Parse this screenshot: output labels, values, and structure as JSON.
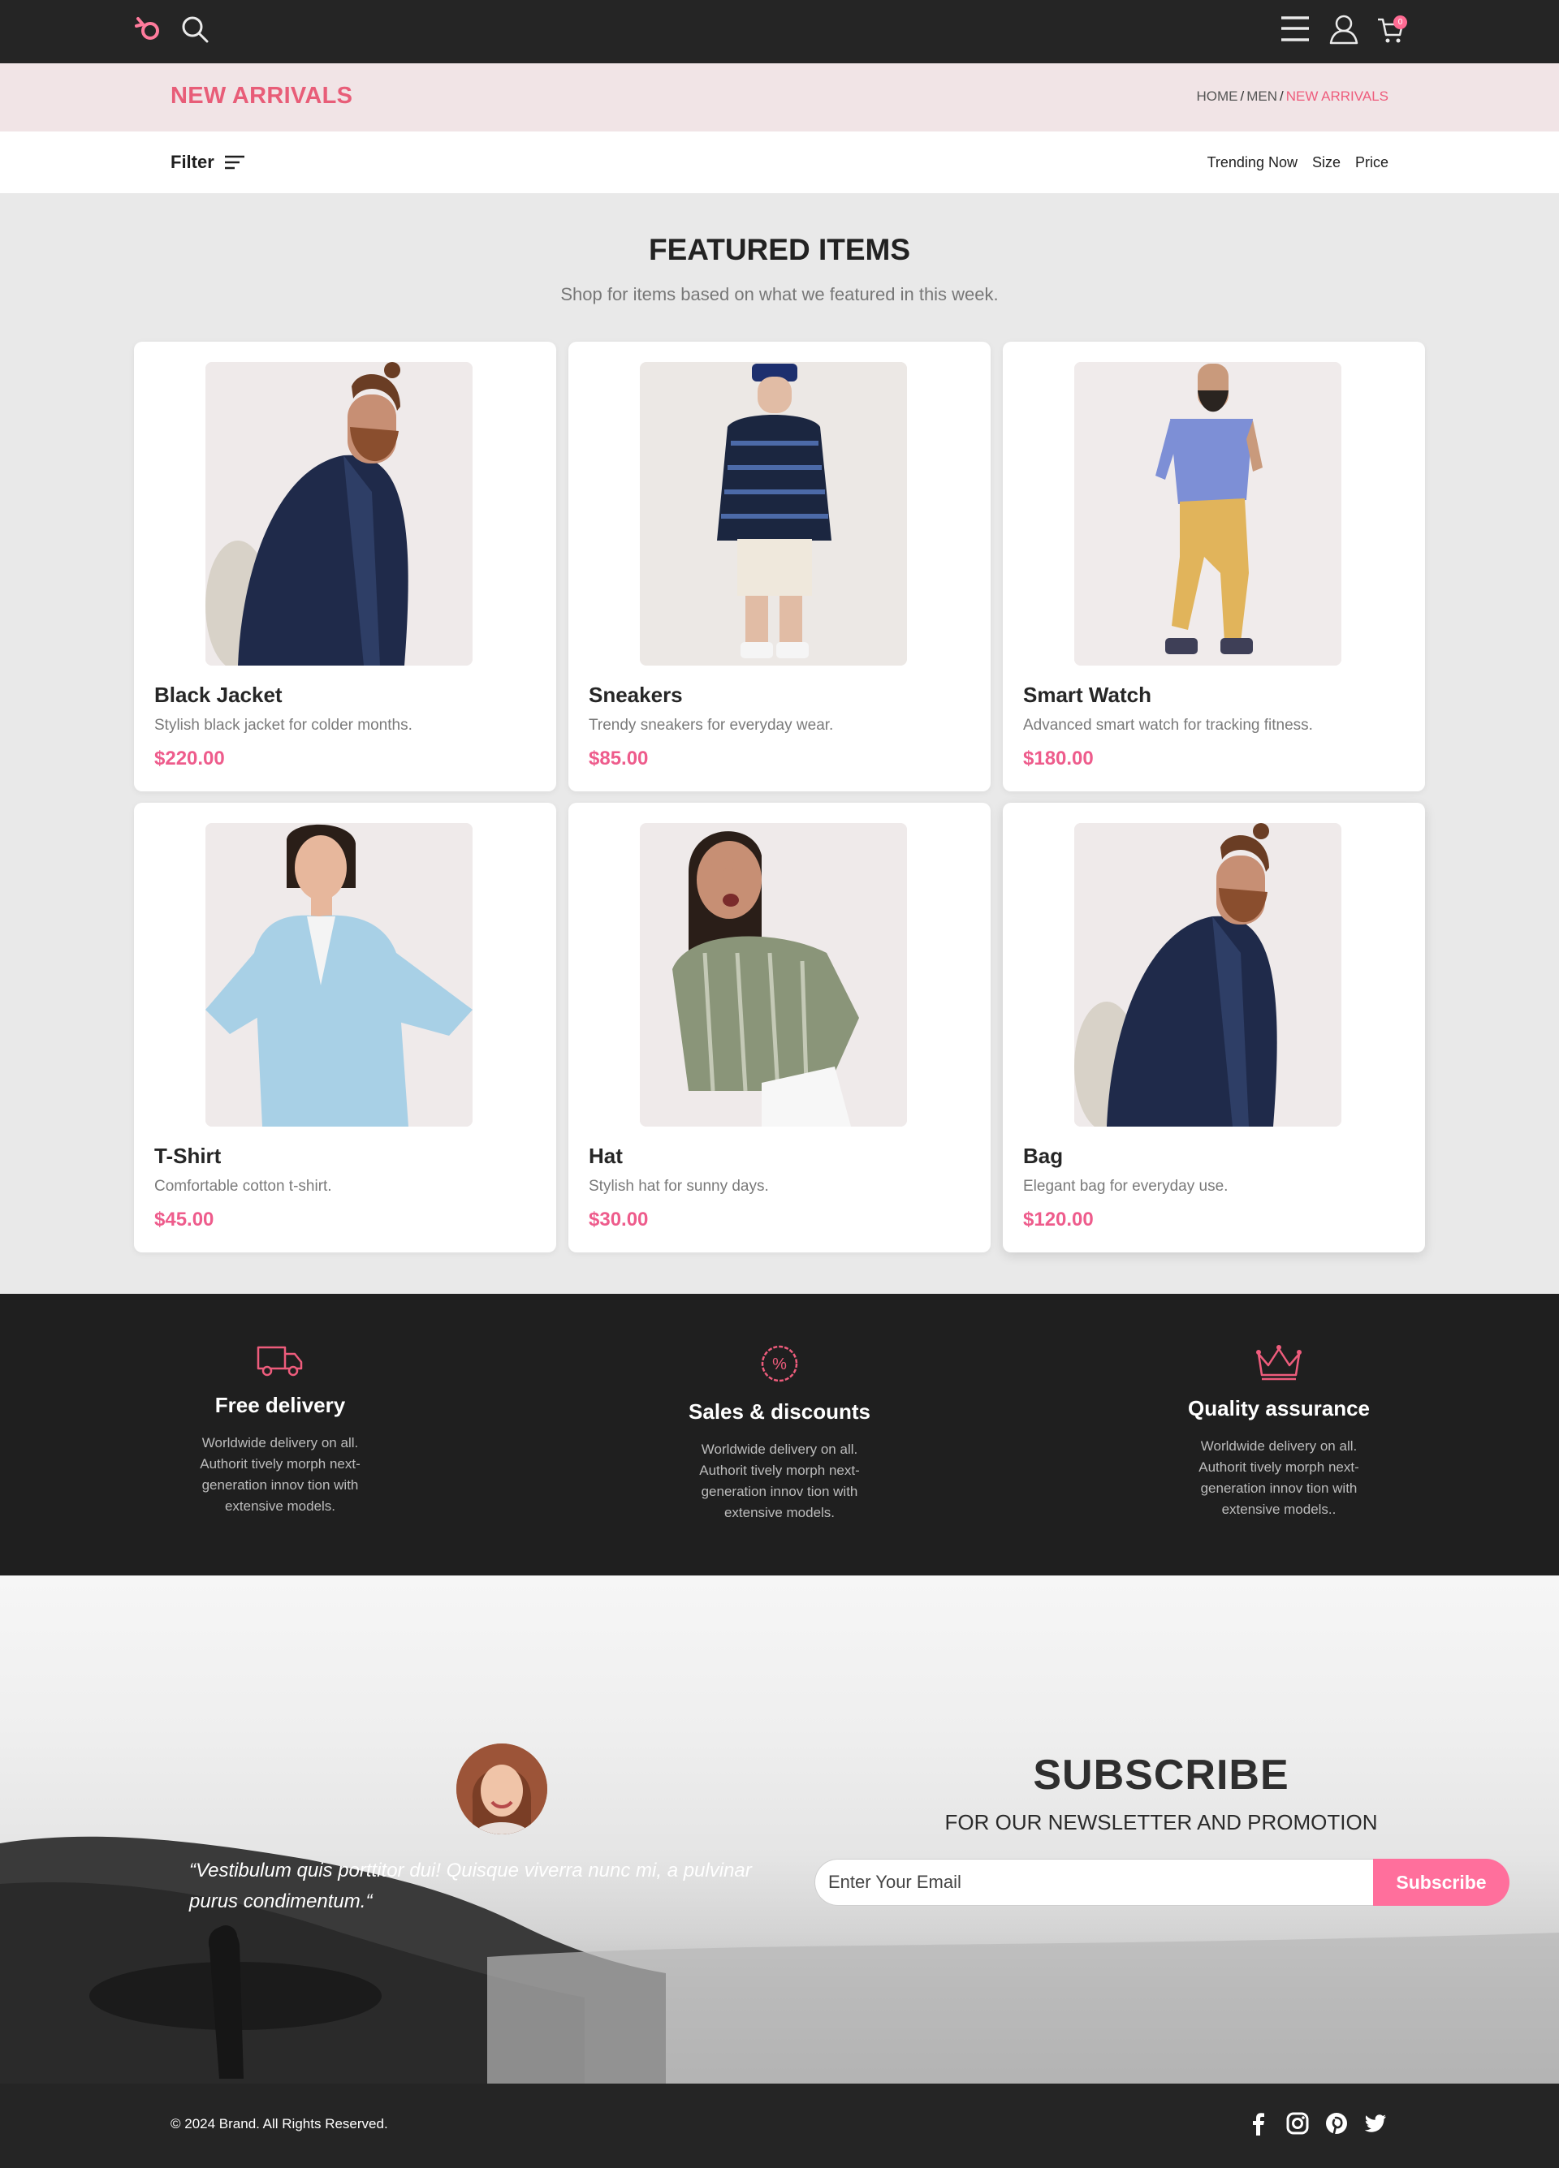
{
  "nav": {
    "cart_count": "0"
  },
  "banner": {
    "title": "NEW ARRIVALS",
    "breadcrumb": [
      "HOME",
      "MEN",
      "NEW ARRIVALS"
    ]
  },
  "filterbar": {
    "filter_label": "Filter",
    "sort_options": [
      "Trending Now",
      "Size",
      "Price"
    ]
  },
  "featured": {
    "title": "FEATURED ITEMS",
    "subtitle": "Shop for items based on what we featured in this week.",
    "products": [
      {
        "name": "Black Jacket",
        "description": "Stylish black jacket for colder months.",
        "price": "$220.00"
      },
      {
        "name": "Sneakers",
        "description": "Trendy sneakers for everyday wear.",
        "price": "$85.00"
      },
      {
        "name": "Smart Watch",
        "description": "Advanced smart watch for tracking fitness.",
        "price": "$180.00"
      },
      {
        "name": "T-Shirt",
        "description": "Comfortable cotton t-shirt.",
        "price": "$45.00"
      },
      {
        "name": "Hat",
        "description": "Stylish hat for sunny days.",
        "price": "$30.00"
      },
      {
        "name": "Bag",
        "description": "Elegant bag for everyday use.",
        "price": "$120.00"
      }
    ]
  },
  "features": [
    {
      "icon": "delivery-truck-icon",
      "title": "Free delivery",
      "description": "Worldwide delivery on all. Authorit tively morph next-generation innov tion with extensive models."
    },
    {
      "icon": "discount-badge-icon",
      "title": "Sales & discounts",
      "description": "Worldwide delivery on all. Authorit tively morph next-generation innov tion with extensive models."
    },
    {
      "icon": "crown-icon",
      "title": "Quality assurance",
      "description": "Worldwide delivery on all. Authorit tively morph next-generation innov tion with extensive models.."
    }
  ],
  "testimonial": {
    "quote": "“Vestibulum quis porttitor dui! Quisque viverra nunc mi, a pulvinar purus condimentum.“"
  },
  "subscribe": {
    "title": "SUBSCRIBE",
    "subtitle": "FOR OUR NEWSLETTER AND PROMOTION",
    "email_placeholder": "Enter Your Email",
    "button_label": "Subscribe"
  },
  "footer": {
    "copyright": "© 2024 Brand. All Rights Reserved.",
    "socials": [
      "facebook-icon",
      "instagram-icon",
      "pinterest-icon",
      "twitter-icon"
    ]
  },
  "colors": {
    "accent": "#ee5c8c",
    "banner_title": "#e85d78",
    "dark": "#252525",
    "subscribe_button": "#ff6f9c"
  }
}
